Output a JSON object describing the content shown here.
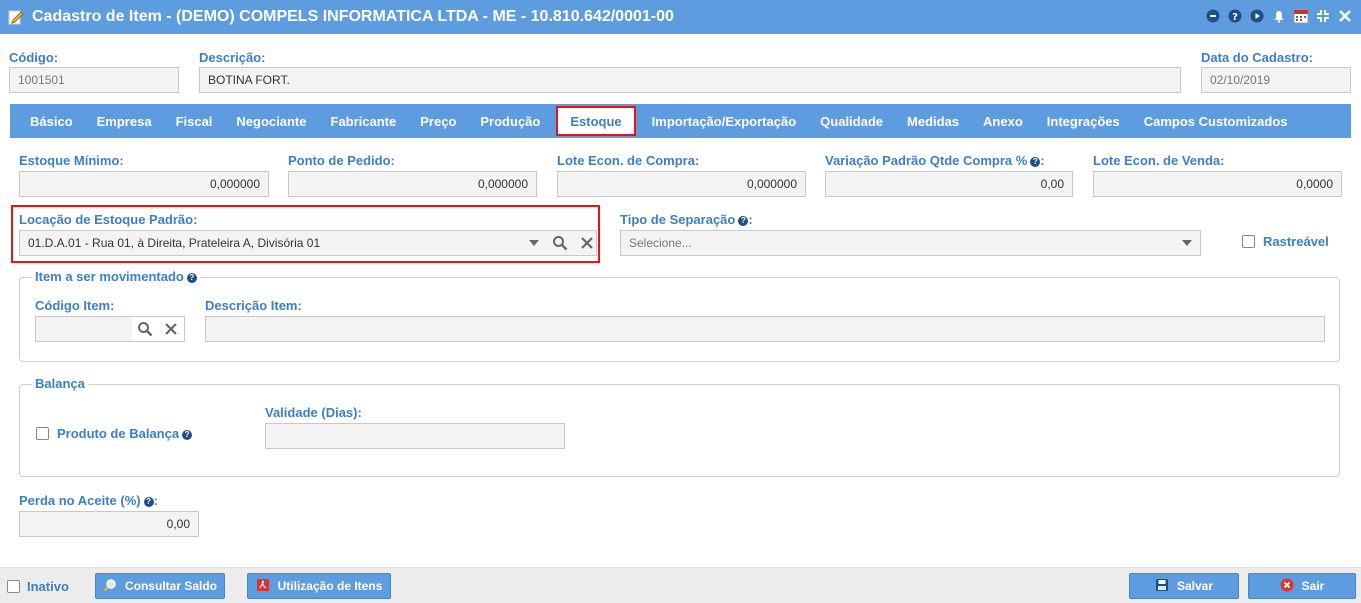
{
  "window": {
    "title": "Cadastro de Item - (DEMO) COMPELS INFORMATICA LTDA - ME - 10.810.642/0001-00"
  },
  "header": {
    "codigo_label": "Código:",
    "codigo_value": "1001501",
    "descricao_label": "Descrição:",
    "descricao_value": "BOTINA FORT.",
    "data_label": "Data do Cadastro:",
    "data_value": "02/10/2019"
  },
  "tabs": [
    {
      "label": "Básico"
    },
    {
      "label": "Empresa"
    },
    {
      "label": "Fiscal"
    },
    {
      "label": "Negociante"
    },
    {
      "label": "Fabricante"
    },
    {
      "label": "Preço"
    },
    {
      "label": "Produção"
    },
    {
      "label": "Estoque",
      "active": true
    },
    {
      "label": "Importação/Exportação"
    },
    {
      "label": "Qualidade"
    },
    {
      "label": "Medidas"
    },
    {
      "label": "Anexo"
    },
    {
      "label": "Integrações"
    },
    {
      "label": "Campos Customizados"
    }
  ],
  "estoque": {
    "minimo_label": "Estoque Mínimo:",
    "minimo_value": "0,000000",
    "ponto_label": "Ponto de Pedido:",
    "ponto_value": "0,000000",
    "lote_compra_label": "Lote Econ. de Compra:",
    "lote_compra_value": "0,000000",
    "variacao_label": "Variação Padrão Qtde Compra %",
    "variacao_value": "0,00",
    "lote_venda_label": "Lote Econ. de Venda:",
    "lote_venda_value": "0,0000",
    "locacao_label": "Locação de Estoque Padrão:",
    "locacao_value": "01.D.A.01 - Rua 01, à Direita, Prateleira A, Divisória 01",
    "separacao_label": "Tipo de Separação",
    "separacao_placeholder": "Selecione...",
    "rastreavel_label": "Rastreável"
  },
  "item_mov": {
    "legend": "Item a ser movimentado",
    "codigo_label": "Código Item:",
    "codigo_value": "",
    "descricao_label": "Descrição Item:",
    "descricao_value": ""
  },
  "balanca": {
    "legend": "Balança",
    "produto_label": "Produto de Balança",
    "validade_label": "Validade (Dias):",
    "validade_value": ""
  },
  "perda": {
    "label": "Perda no Aceite (%)",
    "value": "0,00"
  },
  "footer": {
    "inativo_label": "Inativo",
    "consultar_label": "Consultar Saldo",
    "utilizacao_label": "Utilização de Itens",
    "salvar_label": "Salvar",
    "sair_label": "Sair"
  },
  "colors": {
    "accent": "#5d9cde",
    "label": "#3c7fc6",
    "highlight": "#ee1111"
  }
}
